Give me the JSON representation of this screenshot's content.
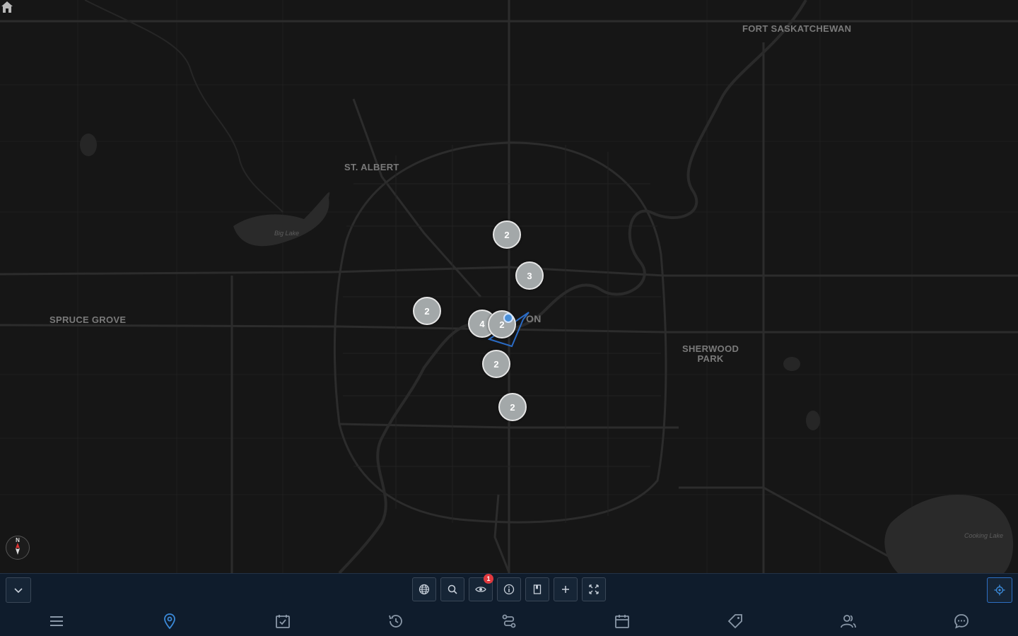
{
  "map": {
    "places": [
      {
        "id": "fort-saskatchewan",
        "label": "FORT SASKATCHEWAN"
      },
      {
        "id": "st-albert",
        "label": "ST. ALBERT"
      },
      {
        "id": "spruce-grove",
        "label": "SPRUCE GROVE"
      },
      {
        "id": "sherwood-park",
        "label": "SHERWOOD\nPARK"
      },
      {
        "id": "edmonton-partial",
        "label": "ON"
      }
    ],
    "water_labels": [
      {
        "id": "big-lake",
        "label": "Big Lake"
      },
      {
        "id": "cooking-lake",
        "label": "Cooking Lake"
      }
    ],
    "clusters": [
      {
        "count": "2"
      },
      {
        "count": "3"
      },
      {
        "count": "2"
      },
      {
        "count": "4"
      },
      {
        "count": "2"
      },
      {
        "count": "2"
      },
      {
        "count": "2"
      }
    ],
    "compass_label": "N"
  },
  "toolbar": {
    "visibility_badge": "1",
    "icons": [
      "globe-icon",
      "search-icon",
      "eye-icon",
      "info-icon",
      "bookmark-icon",
      "plus-icon",
      "fullscreen-icon"
    ]
  },
  "nav": {
    "items": [
      "menu-icon",
      "map-pin-icon",
      "checklist-icon",
      "history-icon",
      "route-icon",
      "calendar-icon",
      "tag-icon",
      "users-icon",
      "chat-icon"
    ],
    "active_color": "#3b8ad9",
    "inactive_color": "#8a98a8"
  }
}
